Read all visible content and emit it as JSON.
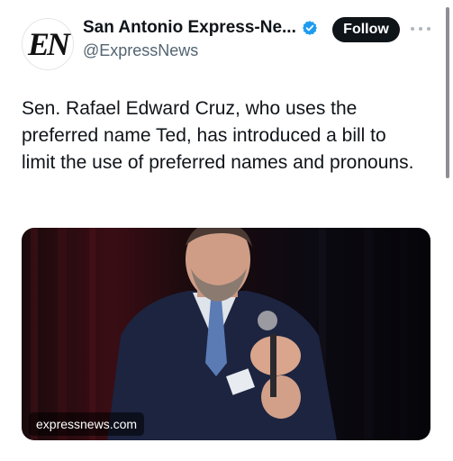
{
  "author": {
    "avatar_text": "EN",
    "display_name": "San Antonio Express-Ne...",
    "handle": "@ExpressNews",
    "verified": true
  },
  "actions": {
    "follow_label": "Follow",
    "more_icon": "more-horizontal-icon"
  },
  "tweet": {
    "text": "Sen. Rafael Edward Cruz, who uses the preferred name Ted, has introduced a bill to limit the use of preferred names and pronouns."
  },
  "media": {
    "card_domain": "expressnews.com"
  },
  "colors": {
    "follow_bg": "#0f1419",
    "verified_blue": "#1d9bf0",
    "handle_gray": "#536471"
  }
}
